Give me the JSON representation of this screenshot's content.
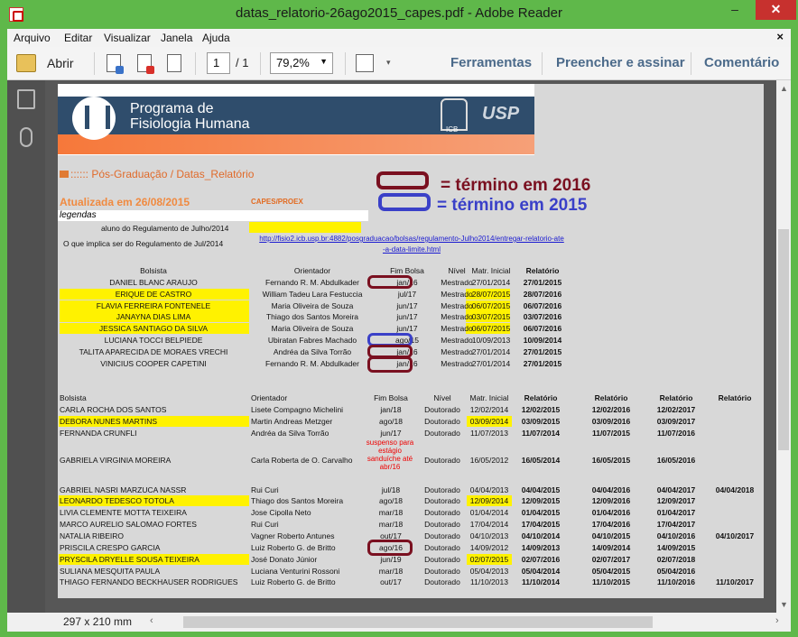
{
  "window": {
    "title": "datas_relatorio-26ago2015_capes.pdf - Adobe Reader",
    "min": "–",
    "max": "☐",
    "close": "✕"
  },
  "menu": {
    "items": [
      "Arquivo",
      "Editar",
      "Visualizar",
      "Janela",
      "Ajuda"
    ],
    "close": "×"
  },
  "toolbar": {
    "open_label": "Abrir",
    "page_current": "1",
    "page_total": "/ 1",
    "zoom": "79,2%",
    "tools": "Ferramentas",
    "fill_sign": "Preencher e assinar",
    "comment": "Comentário"
  },
  "status": {
    "page_size": "297 x 210 mm"
  },
  "doc": {
    "banner": {
      "line1": "Programa de",
      "line2": "Fisiologia Humana",
      "icb": "ICB",
      "usp": "USP"
    },
    "breadcrumb": ":::::: Pós-Graduação / Datas_Relatório",
    "updated": "Atualizada em 26/08/2015",
    "capes": "CAPES/PROEX",
    "legend_2016": "= término em 2016",
    "legend_2015": "= término em 2015",
    "legendas": "legendas",
    "reg_july": "aluno do Regulamento de Julho/2014",
    "reg_implies": "O que implica ser do Regulamento de Jul/2014",
    "reg_link": "http://fisio2.icb.usp.br:4882/posgraduacao/bolsas/regulamento-Julho2014/entregar-relatorio-ate-a-data-limite.html",
    "ms": {
      "headers": [
        "Bolsista",
        "Orientador",
        "Fim Bolsa",
        "Nível",
        "Matr. Inicial",
        "Relatório"
      ],
      "rows": [
        [
          "DANIEL BLANC ARAUJO",
          "Fernando R. M. Abdulkader",
          "jan/16",
          "Mestrado",
          "27/01/2014",
          "27/01/2015"
        ],
        [
          "ERIQUE DE CASTRO",
          "William Tadeu Lara Festuccia",
          "jul/17",
          "Mestrado",
          "28/07/2015",
          "28/07/2016"
        ],
        [
          "FLAVIA FERREIRA FONTENELE",
          "Maria Oliveira de Souza",
          "jun/17",
          "Mestrado",
          "06/07/2015",
          "06/07/2016"
        ],
        [
          "JANAYNA DIAS LIMA",
          "Thiago dos Santos Moreira",
          "jun/17",
          "Mestrado",
          "03/07/2015",
          "03/07/2016"
        ],
        [
          "JESSICA SANTIAGO DA SILVA",
          "Maria Oliveira de Souza",
          "jun/17",
          "Mestrado",
          "06/07/2015",
          "06/07/2016"
        ],
        [
          "LUCIANA TOCCI BELPIEDE",
          "Ubiratan Fabres Machado",
          "ago/15",
          "Mestrado",
          "10/09/2013",
          "10/09/2014"
        ],
        [
          "TALITA APARECIDA DE MORAES VRECHI",
          "Andréa da Silva Torrão",
          "jan/16",
          "Mestrado",
          "27/01/2014",
          "27/01/2015"
        ],
        [
          "VINICIUS COOPER CAPETINI",
          "Fernando R. M. Abdulkader",
          "jan/16",
          "Mestrado",
          "27/01/2014",
          "27/01/2015"
        ]
      ]
    },
    "dr": {
      "headers": [
        "Bolsista",
        "Orientador",
        "Fim Bolsa",
        "Nível",
        "Matr. Inicial",
        "Relatório",
        "Relatório",
        "Relatório",
        "Relatório"
      ],
      "rows": [
        [
          "CARLA ROCHA DOS SANTOS",
          "Lisete Compagno Michelini",
          "jan/18",
          "Doutorado",
          "12/02/2014",
          "12/02/2015",
          "12/02/2016",
          "12/02/2017",
          ""
        ],
        [
          "DEBORA NUNES MARTINS",
          "Martin Andreas Metzger",
          "ago/18",
          "Doutorado",
          "03/09/2014",
          "03/09/2015",
          "03/09/2016",
          "03/09/2017",
          ""
        ],
        [
          "FERNANDA CRUNFLI",
          "Andréa da Silva Torrão",
          "jun/17",
          "Doutorado",
          "11/07/2013",
          "11/07/2014",
          "11/07/2015",
          "11/07/2016",
          ""
        ],
        [
          "GABRIELA VIRGINIA MOREIRA",
          "Carla Roberta de O. Carvalho",
          "",
          "Doutorado",
          "16/05/2012",
          "16/05/2014",
          "16/05/2015",
          "16/05/2016",
          ""
        ],
        [
          "GABRIEL NASRI MARZUCA NASSR",
          "Rui Curi",
          "jul/18",
          "Doutorado",
          "04/04/2013",
          "04/04/2015",
          "04/04/2016",
          "04/04/2017",
          "04/04/2018"
        ],
        [
          "LEONARDO TEDESCO TOTOLA",
          "Thiago dos Santos Moreira",
          "ago/18",
          "Doutorado",
          "12/09/2014",
          "12/09/2015",
          "12/09/2016",
          "12/09/2017",
          ""
        ],
        [
          "LIVIA CLEMENTE MOTTA TEIXEIRA",
          "Jose Cipolla Neto",
          "mar/18",
          "Doutorado",
          "01/04/2014",
          "01/04/2015",
          "01/04/2016",
          "01/04/2017",
          ""
        ],
        [
          "MARCO AURELIO SALOMAO FORTES",
          "Rui Curi",
          "mar/18",
          "Doutorado",
          "17/04/2014",
          "17/04/2015",
          "17/04/2016",
          "17/04/2017",
          ""
        ],
        [
          "NATALIA RIBEIRO",
          "Vagner Roberto Antunes",
          "out/17",
          "Doutorado",
          "04/10/2013",
          "04/10/2014",
          "04/10/2015",
          "04/10/2016",
          "04/10/2017"
        ],
        [
          "PRISCILA CRESPO GARCIA",
          "Luiz Roberto G. de Britto",
          "ago/16",
          "Doutorado",
          "14/09/2012",
          "14/09/2013",
          "14/09/2014",
          "14/09/2015",
          ""
        ],
        [
          "PRYSCILA DRYELLE SOUSA TEIXEIRA",
          "José Donato Júnior",
          "jun/19",
          "Doutorado",
          "02/07/2015",
          "02/07/2016",
          "02/07/2017",
          "02/07/2018",
          ""
        ],
        [
          "SULIANA MESQUITA PAULA",
          "Luciana Venturini Rossoni",
          "mar/18",
          "Doutorado",
          "05/04/2013",
          "05/04/2014",
          "05/04/2015",
          "05/04/2016",
          ""
        ],
        [
          "THIAGO FERNANDO BECKHAUSER RODRIGUES",
          "Luiz Roberto G. de Britto",
          "out/17",
          "Doutorado",
          "11/10/2013",
          "11/10/2014",
          "11/10/2015",
          "11/10/2016",
          "11/10/2017"
        ]
      ],
      "suspended_note": "suspenso para estágio sanduíche até abr/16"
    },
    "colors": {
      "mark_2016": "#7a1020",
      "mark_2015": "#3a40c8",
      "highlight": "#fff200"
    }
  }
}
